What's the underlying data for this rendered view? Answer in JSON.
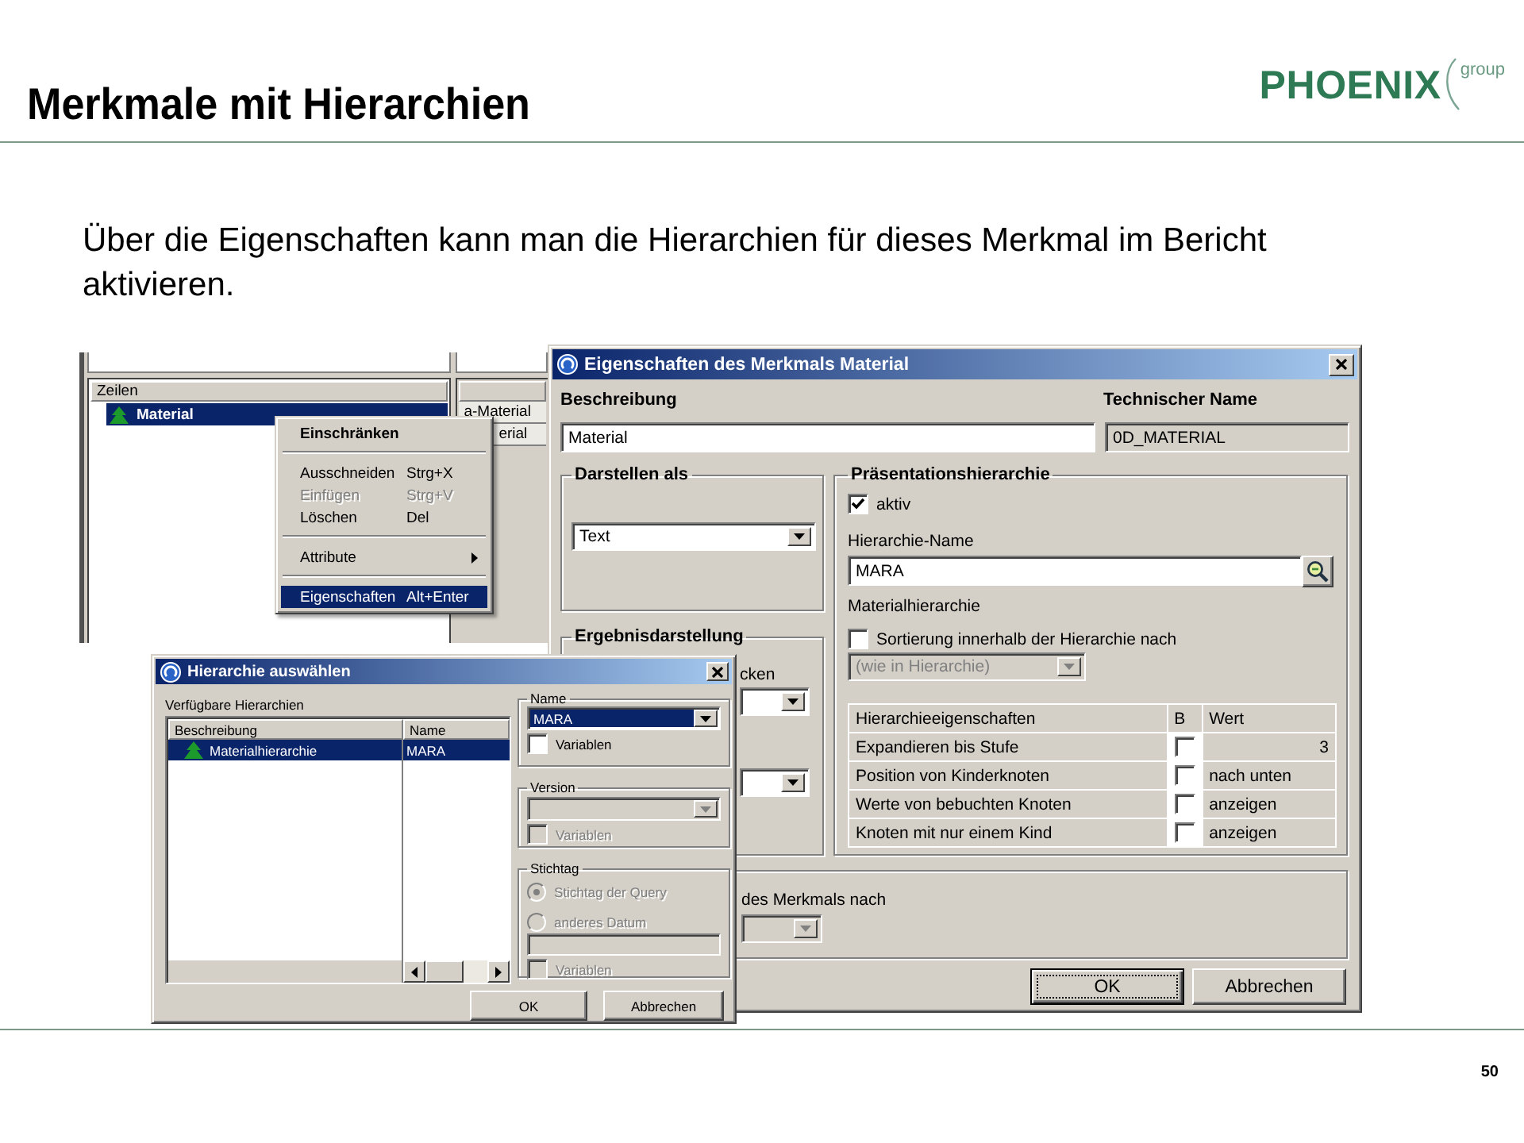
{
  "slide": {
    "title": "Merkmale mit Hierarchien",
    "logo_name": "PHOENIX",
    "logo_suffix": "group",
    "text": "Über die Eigenschaften kann man die Hierarchien für dieses Merkmal im Bericht aktivieren.",
    "page_number": "50"
  },
  "query_pane": {
    "rows_header": "Zeilen",
    "rows": [
      {
        "label": "Material",
        "selected": true
      }
    ],
    "column_cells": [
      "a-Material",
      "erial"
    ],
    "context_menu": [
      {
        "kind": "item",
        "label": "Einschränken",
        "default": true,
        "disabled": false,
        "selected": false
      },
      {
        "kind": "separator"
      },
      {
        "kind": "item",
        "label": "Ausschneiden",
        "shortcut": "Strg+X",
        "default": false,
        "disabled": false,
        "selected": false
      },
      {
        "kind": "item",
        "label": "Einfügen",
        "shortcut": "Strg+V",
        "default": false,
        "disabled": true,
        "selected": false
      },
      {
        "kind": "item",
        "label": "Löschen",
        "shortcut": "Del",
        "default": false,
        "disabled": false,
        "selected": false
      },
      {
        "kind": "separator"
      },
      {
        "kind": "submenu",
        "label": "Attribute",
        "default": false,
        "disabled": false,
        "selected": false
      },
      {
        "kind": "separator"
      },
      {
        "kind": "item",
        "label": "Eigenschaften",
        "shortcut": "Alt+Enter",
        "default": false,
        "disabled": false,
        "selected": true
      }
    ]
  },
  "properties_dialog": {
    "title": "Eigenschaften des Merkmals Material",
    "description_label": "Beschreibung",
    "description": "Material",
    "technical_name_label": "Technischer Name",
    "technical_name": "0D_MATERIAL",
    "display_group": {
      "title": "Darstellen als",
      "value": "Text"
    },
    "result_group": {
      "title": "Ergebnisdarstellung",
      "text": "cken"
    },
    "hierarchy_group": {
      "title": "Präsentationshierarchie",
      "active": {
        "label": "aktiv",
        "checked": true
      },
      "name_label": "Hierarchie-Name",
      "name": "MARA",
      "name_description": "Materialhierarchie",
      "sort": {
        "label": "Sortierung innerhalb der Hierarchie nach",
        "checked": false
      },
      "sort_value": "(wie in Hierarchie)",
      "sort_value_disabled": true,
      "table": {
        "columns": [
          "Hierarchieeigenschaften",
          "B",
          "Wert"
        ],
        "rows": [
          {
            "property": "Expandieren bis Stufe",
            "checked": false,
            "value": "3",
            "kind": "number"
          },
          {
            "property": "Position von Kinderknoten",
            "checked": false,
            "value": "nach unten",
            "kind": "text"
          },
          {
            "property": "Werte von bebuchten Knoten",
            "checked": false,
            "value": "anzeigen",
            "kind": "text"
          },
          {
            "property": "Knoten mit nur einem Kind",
            "checked": false,
            "value": "anzeigen",
            "kind": "text"
          }
        ]
      }
    },
    "sort_group": {
      "text": "des Merkmals nach"
    },
    "buttons": [
      {
        "label": "OK",
        "default": true
      },
      {
        "label": "Abbrechen",
        "default": false
      }
    ]
  },
  "hierarchy_dialog": {
    "title": "Hierarchie auswählen",
    "list_label": "Verfügbare Hierarchien",
    "columns": [
      "Beschreibung",
      "Name"
    ],
    "rows": [
      {
        "description": "Materialhierarchie",
        "name": "MARA",
        "selected": true
      }
    ],
    "name_group": {
      "title": "Name",
      "value": "MARA",
      "focused": true,
      "disabled": false,
      "variables": {
        "label": "Variablen",
        "checked": false,
        "disabled": false
      }
    },
    "version_group": {
      "title": "Version",
      "disabled": true,
      "variables": {
        "label": "Variablen",
        "checked": false,
        "disabled": true
      }
    },
    "key_date_group": {
      "title": "Stichtag",
      "options": [
        {
          "label": "Stichtag der Query",
          "selected": true,
          "disabled": true
        },
        {
          "label": "anderes Datum",
          "selected": false,
          "disabled": true
        }
      ],
      "date_disabled": true,
      "variables": {
        "label": "Variablen",
        "checked": false,
        "disabled": true
      }
    },
    "buttons": [
      {
        "label": "OK",
        "default": false
      },
      {
        "label": "Abbrechen",
        "default": false
      }
    ]
  }
}
